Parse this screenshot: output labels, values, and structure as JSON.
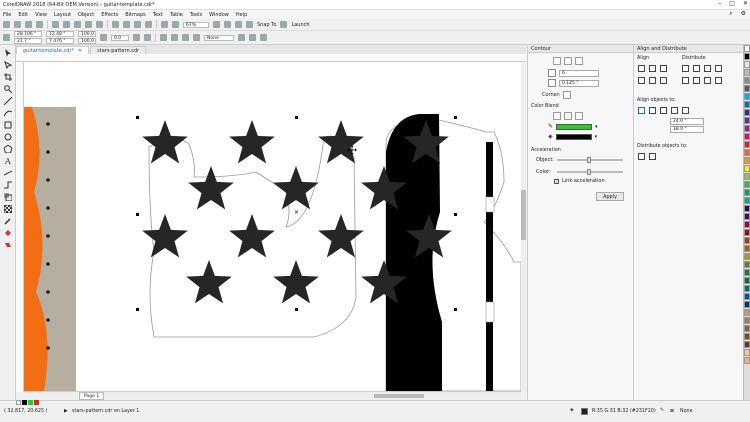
{
  "window": {
    "title": "CorelDRAW 2018 (64-Bit OEM Version) - guitar-template.cdr*"
  },
  "menu": {
    "items": [
      "File",
      "Edit",
      "View",
      "Layout",
      "Object",
      "Effects",
      "Bitmaps",
      "Text",
      "Table",
      "Tools",
      "Window",
      "Help"
    ]
  },
  "toolbar": {
    "zoom": "67%",
    "snap_label": "Snap To",
    "launch_label": "Launch"
  },
  "propertybar": {
    "x": "28.106 \"",
    "y": "21.7 \"",
    "width": "12.48 \"",
    "height": "7.476 \"",
    "scale_w": "100.0",
    "scale_h": "100.0",
    "angle": "0.0",
    "outline": "None"
  },
  "tabs": [
    {
      "label": "guitar-template.cdr*",
      "active": true
    },
    {
      "label": "stars-pattern.cdr",
      "active": false
    }
  ],
  "page_tab": "Page 1",
  "contour": {
    "title": "Contour",
    "steps": "6",
    "offset": "0.125 \"",
    "corners_label": "Corner:",
    "color_blend_label": "Color Blend",
    "outline_color": "#1fd11f",
    "fill_color": "#000000",
    "acceleration_label": "Acceleration",
    "object_label": "Object:",
    "color_label": "Color:",
    "link_label": "Link acceleration",
    "link_checked": true,
    "object_accel": 0.45,
    "color_accel": 0.45,
    "apply_label": "Apply"
  },
  "align": {
    "title": "Align and Distribute",
    "align_label": "Align",
    "distribute_label": "Distribute",
    "align_to_label": "Align objects to:",
    "x_value": "24.0 \"",
    "y_value": "18.0 \"",
    "distribute_to_label": "Distribute objects to:"
  },
  "palette": {
    "colors": [
      "#ffffff",
      "#000000",
      "#e6e6e6",
      "#bdbdbd",
      "#8c8c8c",
      "#595959",
      "#00aeef",
      "#0072bc",
      "#2e3192",
      "#662d91",
      "#92278f",
      "#ec008c",
      "#ed1c24",
      "#f26522",
      "#f7941d",
      "#fff200",
      "#8dc63f",
      "#39b54a",
      "#00a651",
      "#00a99d",
      "#1b1464",
      "#440e62",
      "#9e005d",
      "#9e0b0f",
      "#a0410d",
      "#a36209",
      "#aba000",
      "#598527",
      "#1a7b30",
      "#007236",
      "#00746b",
      "#0054a6",
      "#003471",
      "#c69c6d",
      "#a67c52",
      "#8c6239",
      "#754c24",
      "#603913",
      "#fdc689",
      "#f9ad81"
    ]
  },
  "status": {
    "coords": "( 32.817, 20.625 )",
    "layer": "stars-pattern.cdr on Layer 1",
    "fill_info": "R:35 G:31 B:32 (#231F20)",
    "outline_info": "None"
  }
}
